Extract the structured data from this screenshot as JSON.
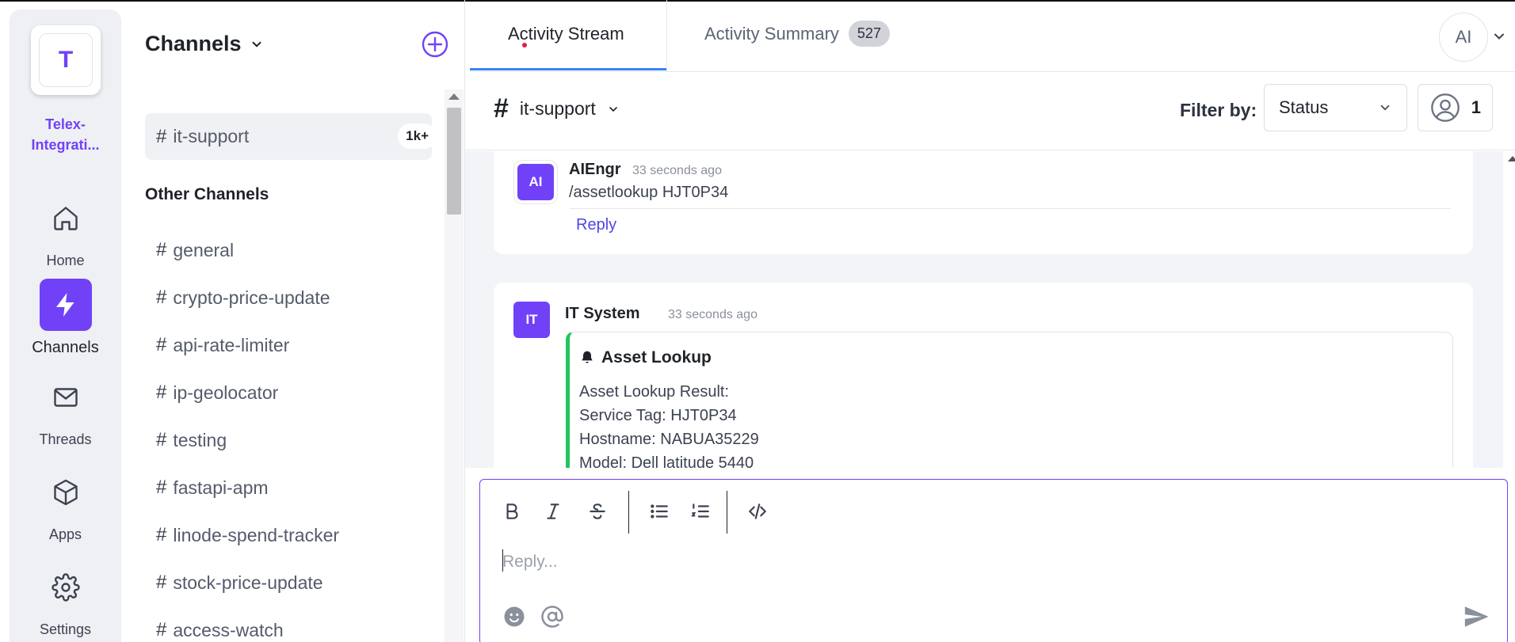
{
  "workspace": {
    "initial": "T",
    "name_line1": "Telex-",
    "name_line2": "Integrati..."
  },
  "rail": {
    "items": [
      {
        "label": "Home",
        "icon": "home-icon"
      },
      {
        "label": "Channels",
        "icon": "lightning-icon",
        "active": true
      },
      {
        "label": "Threads",
        "icon": "mail-icon"
      },
      {
        "label": "Apps",
        "icon": "box-icon"
      },
      {
        "label": "Settings",
        "icon": "gear-icon"
      }
    ]
  },
  "channels": {
    "title": "Channels",
    "active": {
      "name": "it-support",
      "badge": "1k+"
    },
    "other_title": "Other Channels",
    "items": [
      "general",
      "crypto-price-update",
      "api-rate-limiter",
      "ip-geolocator",
      "testing",
      "fastapi-apm",
      "linode-spend-tracker",
      "stock-price-update",
      "access-watch"
    ]
  },
  "tabs": {
    "stream": "Activity Stream",
    "summary": "Activity Summary",
    "summary_count": "527"
  },
  "user": {
    "initials": "AI"
  },
  "subbar": {
    "hash": "#",
    "channel": "it-support",
    "filter_label": "Filter by:",
    "filter_value": "Status",
    "members_count": "1"
  },
  "messages": [
    {
      "avatar": "AI",
      "author": "AIEngr",
      "time": "33 seconds ago",
      "text": "/assetlookup HJT0P34",
      "reply": "Reply"
    },
    {
      "avatar": "IT",
      "author": "IT System",
      "time": "33 seconds ago",
      "embed": {
        "title": "Asset Lookup",
        "lines": [
          "Asset Lookup Result:",
          "Service Tag: HJT0P34",
          "Hostname: NABUA35229",
          "Model: Dell latitude 5440"
        ]
      }
    }
  ],
  "composer": {
    "placeholder": "Reply..."
  },
  "colors": {
    "accent": "#7141f8",
    "embed_border": "#22c55e",
    "tab_underline": "#3b82f6",
    "link": "#4f46e5"
  }
}
